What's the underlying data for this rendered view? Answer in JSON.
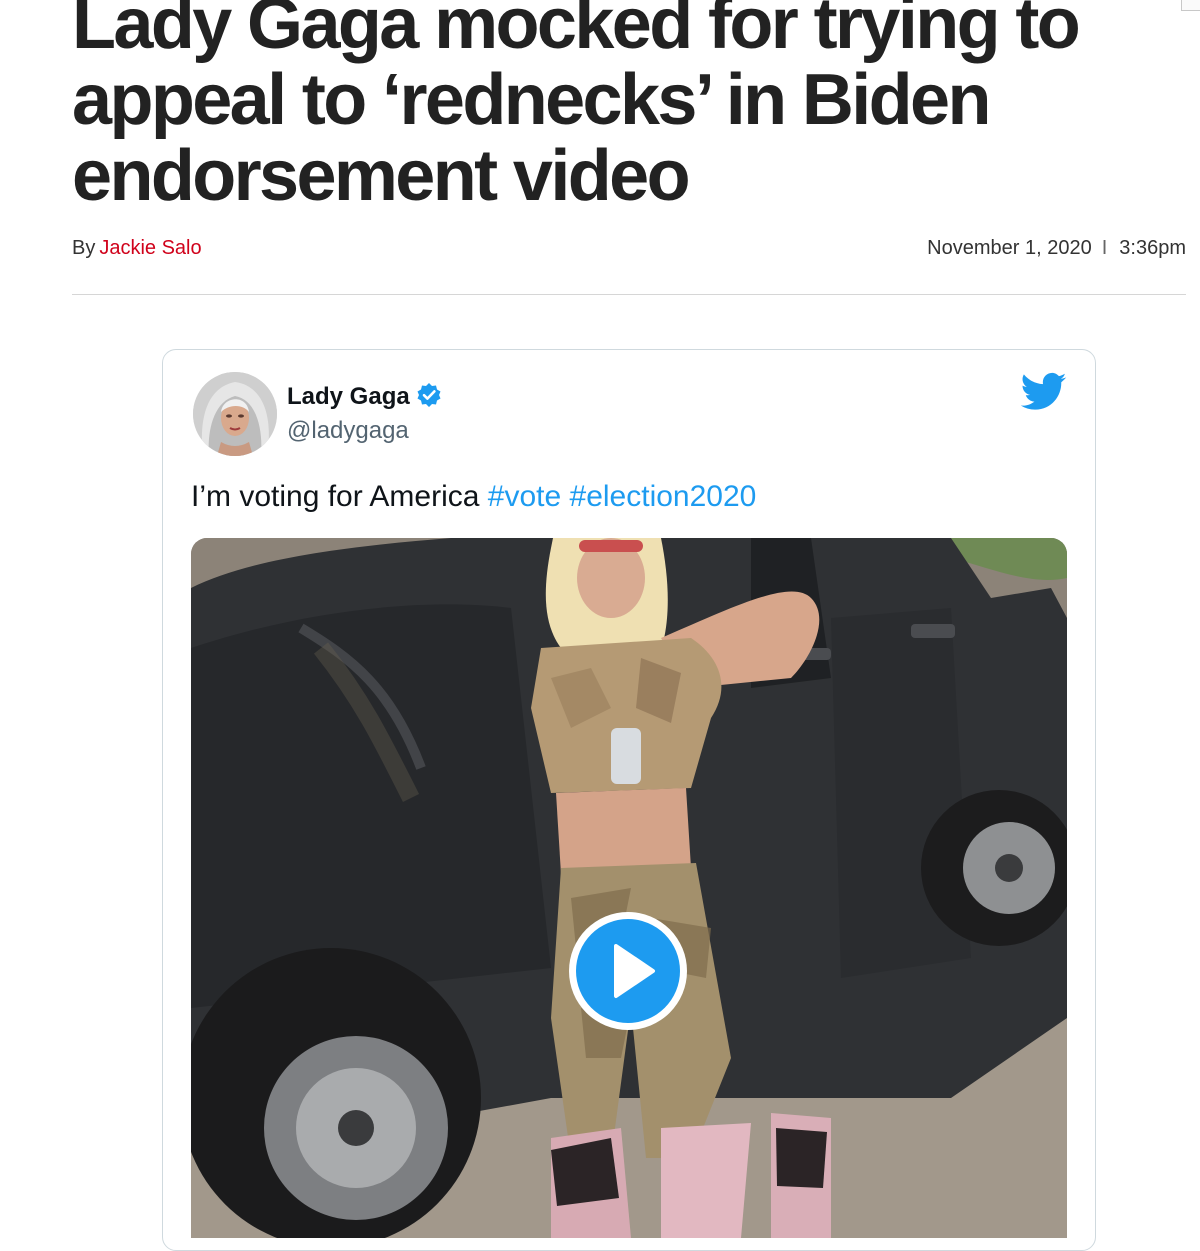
{
  "article": {
    "headline": "Lady Gaga mocked for trying to appeal to ‘rednecks’ in Biden endorsement video",
    "byline_prefix": "By",
    "author": "Jackie Salo",
    "date": "November 1, 2020",
    "separator": "I",
    "time": "3:36pm"
  },
  "tweet": {
    "display_name": "Lady Gaga",
    "handle": "@ladygaga",
    "text": "I’m voting for America",
    "hashtags": [
      "#vote",
      "#election2020"
    ],
    "icons": {
      "verified": "verified-badge-icon",
      "brand": "twitter-bird-icon",
      "play": "play-icon"
    },
    "media": "video"
  },
  "colors": {
    "headline": "#222222",
    "author_link": "#d0021b",
    "twitter_blue": "#1d9bf0",
    "handle_gray": "#536471",
    "rule": "#d6d6d6"
  }
}
